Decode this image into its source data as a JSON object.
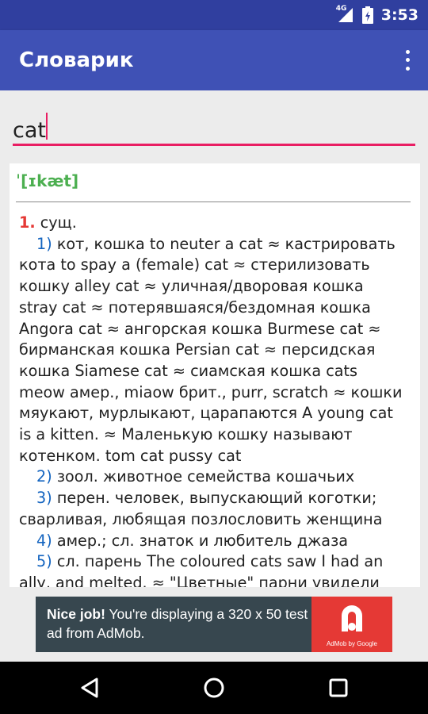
{
  "status_bar": {
    "time": "3:53",
    "network": "4G",
    "icons": [
      "signal-icon",
      "battery-icon"
    ]
  },
  "app_bar": {
    "title": "Словарик",
    "menu_icon": "more-vert-icon"
  },
  "search": {
    "value": "cat",
    "accent_color": "#e91e63"
  },
  "entry": {
    "transcription": "ˈ[ɪkæt]",
    "sense_number": "1.",
    "part_of_speech": "сущ.",
    "subsenses": [
      {
        "num": "1)",
        "lines": [
          "кот, кошка to neuter a cat ≈ кастрировать",
          "кота to spay a (female) cat ≈ стерилизовать",
          "кошку alley cat ≈ уличная/дворовая кошка",
          "stray cat ≈ потерявшаяся/бездомная кошка",
          "Angora cat ≈ ангорская кошка Burmese cat ≈",
          "бирманская кошка Persian cat ≈ персидская",
          "кошка Siamese cat ≈ сиамская кошка cats",
          "meow амер., miaow брит., purr, scratch ≈ кошки",
          "мяукают, мурлыкают, царапаются A young cat",
          "is a kitten. ≈ Маленькую кошку называют",
          "котенком. tom cat pussy cat"
        ]
      },
      {
        "num": "2)",
        "lines": [
          "зоол. животное семейства кошачьих"
        ]
      },
      {
        "num": "3)",
        "lines": [
          "перен. человек, выпускающий коготки;",
          "сварливая, любящая позлословить женщина"
        ]
      },
      {
        "num": "4)",
        "lines": [
          "амер.; сл. знаток и любитель джаза"
        ]
      },
      {
        "num": "5)",
        "lines": [
          "сл. парень The coloured cats saw I had an",
          "ally, and melted. ≈ \"Цветные\" парни увидели"
        ]
      }
    ],
    "colors": {
      "transcription": "#4caf50",
      "sense_number": "#e53935",
      "subsense_number": "#1565c0"
    }
  },
  "ad": {
    "headline": "Nice job!",
    "body": " You're displaying a 320 x 50 test ad from AdMob.",
    "logo_caption": "AdMob by Google"
  },
  "nav_bar": {
    "icons": [
      "back-icon",
      "home-icon",
      "recents-icon"
    ]
  },
  "colors": {
    "status_bar": "#303f9f",
    "app_bar": "#3f51b5"
  }
}
